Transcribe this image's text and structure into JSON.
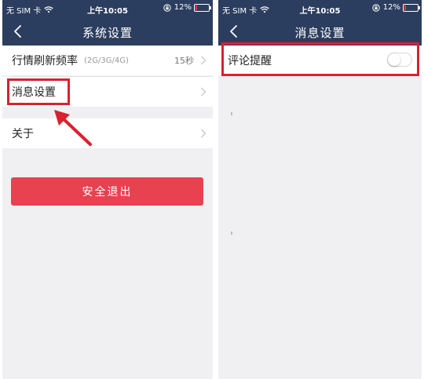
{
  "status_bar": {
    "carrier": "无 SIM 卡",
    "time": "上午10:05",
    "battery": "12%",
    "battery_level": 0.12
  },
  "left_screen": {
    "title": "系统设置",
    "rows": [
      {
        "label": "行情刷新频率",
        "hint": "(2G/3G/4G)",
        "value": "15秒"
      },
      {
        "label": "消息设置"
      },
      {
        "label": "关于"
      }
    ],
    "logout_label": "安全退出"
  },
  "right_screen": {
    "title": "消息设置",
    "rows": [
      {
        "label": "评论提醒",
        "toggle_on": false
      }
    ]
  },
  "colors": {
    "nav_bar": "#2c3e5f",
    "logout_button": "#e84150",
    "highlight": "#d9212f",
    "background": "#f0f0f3"
  }
}
